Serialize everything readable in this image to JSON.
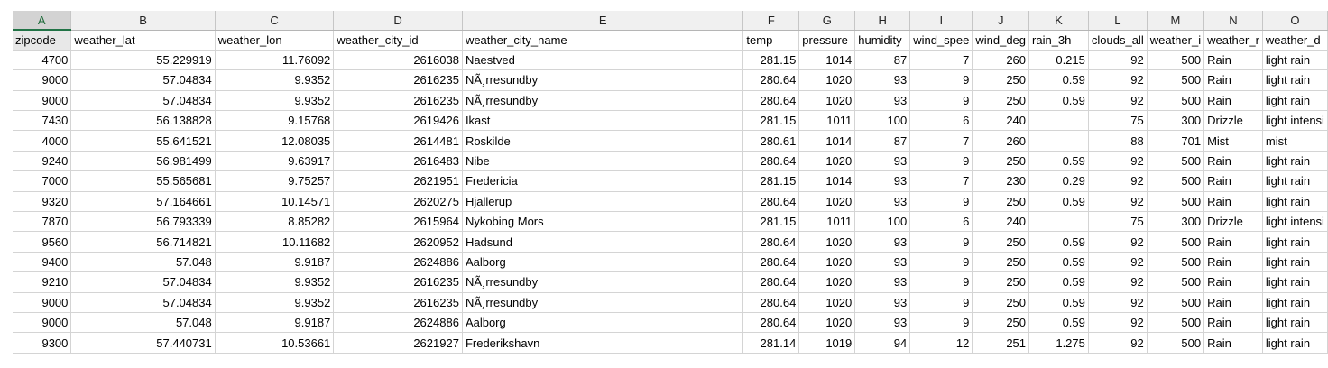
{
  "columns": [
    "A",
    "B",
    "C",
    "D",
    "E",
    "F",
    "G",
    "H",
    "I",
    "J",
    "K",
    "L",
    "M",
    "N",
    "O"
  ],
  "headers": [
    "zipcode",
    "weather_lat",
    "weather_lon",
    "weather_city_id",
    "weather_city_name",
    "temp",
    "pressure",
    "humidity",
    "wind_spee",
    "wind_deg",
    "rain_3h",
    "clouds_all",
    "weather_i",
    "weather_r",
    "weather_d"
  ],
  "rows": [
    [
      "4700",
      "55.229919",
      "11.76092",
      "2616038",
      "Naestved",
      "281.15",
      "1014",
      "87",
      "7",
      "260",
      "0.215",
      "92",
      "500",
      "Rain",
      "light rain"
    ],
    [
      "9000",
      "57.04834",
      "9.9352",
      "2616235",
      "NÃ¸rresundby",
      "280.64",
      "1020",
      "93",
      "9",
      "250",
      "0.59",
      "92",
      "500",
      "Rain",
      "light rain"
    ],
    [
      "9000",
      "57.04834",
      "9.9352",
      "2616235",
      "NÃ¸rresundby",
      "280.64",
      "1020",
      "93",
      "9",
      "250",
      "0.59",
      "92",
      "500",
      "Rain",
      "light rain"
    ],
    [
      "7430",
      "56.138828",
      "9.15768",
      "2619426",
      "Ikast",
      "281.15",
      "1011",
      "100",
      "6",
      "240",
      "",
      "75",
      "300",
      "Drizzle",
      "light intensi"
    ],
    [
      "4000",
      "55.641521",
      "12.08035",
      "2614481",
      "Roskilde",
      "280.61",
      "1014",
      "87",
      "7",
      "260",
      "",
      "88",
      "701",
      "Mist",
      "mist"
    ],
    [
      "9240",
      "56.981499",
      "9.63917",
      "2616483",
      "Nibe",
      "280.64",
      "1020",
      "93",
      "9",
      "250",
      "0.59",
      "92",
      "500",
      "Rain",
      "light rain"
    ],
    [
      "7000",
      "55.565681",
      "9.75257",
      "2621951",
      "Fredericia",
      "281.15",
      "1014",
      "93",
      "7",
      "230",
      "0.29",
      "92",
      "500",
      "Rain",
      "light rain"
    ],
    [
      "9320",
      "57.164661",
      "10.14571",
      "2620275",
      "Hjallerup",
      "280.64",
      "1020",
      "93",
      "9",
      "250",
      "0.59",
      "92",
      "500",
      "Rain",
      "light rain"
    ],
    [
      "7870",
      "56.793339",
      "8.85282",
      "2615964",
      "Nykobing Mors",
      "281.15",
      "1011",
      "100",
      "6",
      "240",
      "",
      "75",
      "300",
      "Drizzle",
      "light intensi"
    ],
    [
      "9560",
      "56.714821",
      "10.11682",
      "2620952",
      "Hadsund",
      "280.64",
      "1020",
      "93",
      "9",
      "250",
      "0.59",
      "92",
      "500",
      "Rain",
      "light rain"
    ],
    [
      "9400",
      "57.048",
      "9.9187",
      "2624886",
      "Aalborg",
      "280.64",
      "1020",
      "93",
      "9",
      "250",
      "0.59",
      "92",
      "500",
      "Rain",
      "light rain"
    ],
    [
      "9210",
      "57.04834",
      "9.9352",
      "2616235",
      "NÃ¸rresundby",
      "280.64",
      "1020",
      "93",
      "9",
      "250",
      "0.59",
      "92",
      "500",
      "Rain",
      "light rain"
    ],
    [
      "9000",
      "57.04834",
      "9.9352",
      "2616235",
      "NÃ¸rresundby",
      "280.64",
      "1020",
      "93",
      "9",
      "250",
      "0.59",
      "92",
      "500",
      "Rain",
      "light rain"
    ],
    [
      "9000",
      "57.048",
      "9.9187",
      "2624886",
      "Aalborg",
      "280.64",
      "1020",
      "93",
      "9",
      "250",
      "0.59",
      "92",
      "500",
      "Rain",
      "light rain"
    ],
    [
      "9300",
      "57.440731",
      "10.53661",
      "2621927",
      "Frederikshavn",
      "281.14",
      "1019",
      "94",
      "12",
      "251",
      "1.275",
      "92",
      "500",
      "Rain",
      "light rain"
    ]
  ],
  "selected_column": "A",
  "colors": {
    "selected_header": "#d3d3d3",
    "selected_text": "#1e6b3a",
    "grid": "#d4d4d4"
  }
}
